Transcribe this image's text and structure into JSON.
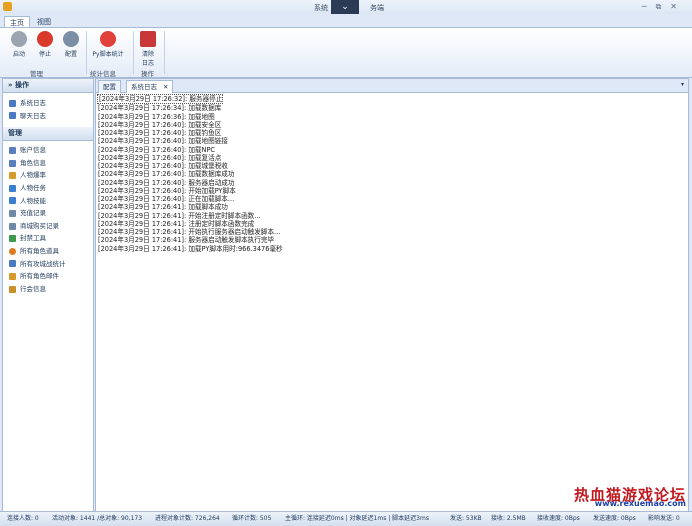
{
  "window": {
    "title_left": "系统",
    "title_right": "务端"
  },
  "ribbon_tabs": [
    "主页",
    "视图"
  ],
  "ribbon": {
    "buttons": [
      {
        "label": "启动",
        "color": "#9aa5b1"
      },
      {
        "label": "停止",
        "color": "#d93a2b"
      },
      {
        "label": "配置",
        "color": "#7a8ea6"
      },
      {
        "label": "Py脚本统计",
        "color": "#e2413b"
      },
      {
        "label": "清除",
        "label2": "日志",
        "color": "#c83838"
      }
    ],
    "groups": [
      "管理",
      "统计信息",
      "操作"
    ]
  },
  "sidebar": {
    "sections": [
      {
        "title": "操作",
        "items": [
          "系统日志",
          "聊天日志"
        ]
      },
      {
        "title": "管理",
        "items": [
          "账户信息",
          "角色信息",
          "人物爆率",
          "人物任务",
          "人物技能",
          "充值记录",
          "商城购买记录",
          "封禁工具",
          "所有角色道具",
          "所有攻城战统计",
          "所有角色邮件",
          "行会信息"
        ]
      }
    ]
  },
  "doc_tabs": [
    "配置",
    "系统日志"
  ],
  "log_lines": [
    "[2024年3月29日 17:26:32]: 服务器停止",
    "[2024年3月29日 17:26:34]: 加载数据库",
    "[2024年3月29日 17:26:36]: 加载地图",
    "[2024年3月29日 17:26:40]: 加载安全区",
    "[2024年3月29日 17:26:40]: 加载钓鱼区",
    "[2024年3月29日 17:26:40]: 加载地图链接",
    "[2024年3月29日 17:26:40]: 加载NPC",
    "[2024年3月29日 17:26:40]: 加载复活点",
    "[2024年3月29日 17:26:40]: 加载城堡税收",
    "[2024年3月29日 17:26:40]: 加载数据库成功",
    "[2024年3月29日 17:26:40]: 服务器启动成功",
    "[2024年3月29日 17:26:40]: 开始加载PY脚本",
    "[2024年3月29日 17:26:40]: 正在加载脚本...",
    "[2024年3月29日 17:26:41]: 加载脚本成功",
    "[2024年3月29日 17:26:41]: 开始注册定时脚本函数...",
    "[2024年3月29日 17:26:41]: 注册定时脚本函数完成",
    "[2024年3月29日 17:26:41]: 开始执行服务器启动触发脚本...",
    "[2024年3月29日 17:26:41]: 服务器启动触发脚本执行完毕",
    "[2024年3月29日 17:26:41]: 加载PY脚本用时:966.3476毫秒"
  ],
  "status": {
    "s0": "连接人数: 0",
    "s1": "活动对象: 1441 /总对象: 90,173",
    "s2": "进程对象计数: 726,264",
    "s3": "循环计数: 505",
    "s4": "主循环: 连接延迟0ms | 对象延迟1ms | 脚本延迟3ms",
    "s5": "发送: 53KB",
    "s6": "接收: 2.5MB",
    "s7": "接收速度: 0Bps",
    "s8": "发送速度: 0Bps",
    "s9": "影响发送: 0"
  },
  "watermark": {
    "text": "热血猫游戏论坛",
    "url": "www.rexuemao.com"
  }
}
